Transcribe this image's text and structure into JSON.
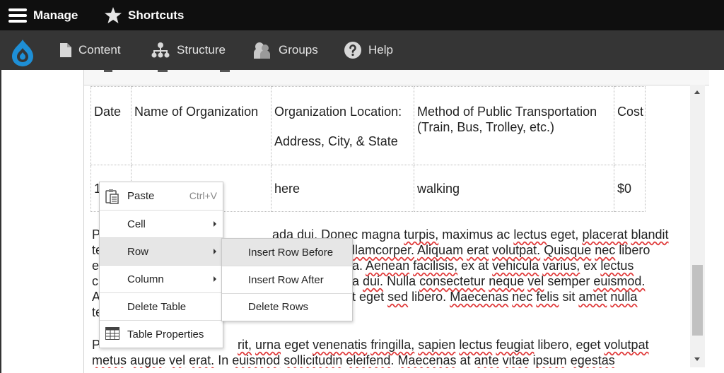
{
  "toolbar": {
    "manage_label": "Manage",
    "shortcuts_label": "Shortcuts"
  },
  "admin_menu": {
    "items": [
      {
        "label": "Content",
        "icon": "document-icon"
      },
      {
        "label": "Structure",
        "icon": "sitemap-icon"
      },
      {
        "label": "Groups",
        "icon": "people-icon"
      },
      {
        "label": "Help",
        "icon": "help-icon"
      }
    ]
  },
  "table": {
    "headers": {
      "date": "Date",
      "org": "Name of Organization",
      "loc_line1": "Organization Location:",
      "loc_line2": "Address, City, & State",
      "method": "Method of Public Transportation (Train, Bus, Trolley, etc.)",
      "cost": "Cost"
    },
    "row": {
      "date": "1",
      "org": "",
      "loc": "here",
      "method": "walking",
      "cost": "$0"
    }
  },
  "paragraph1": {
    "l1a": "P",
    "l1b": "ada dui. Donec magna turpis, maximus ac lectus eget, placerat blandit",
    "l2a": "te",
    "l2b": "llamcorper. Aliquam erat volutpat. Quisque nec libero",
    "l3a": "e",
    "l3b": "a. Aenean facilisis, ex at vehicula varius, ex lectus",
    "l4a": "c",
    "l4b": "a dui. Nulla consectetur neque vel semper euismod.",
    "l5a": "A",
    "l5b": "t eget sed libero. Maecenas nec felis sit amet nulla",
    "l6a": "te"
  },
  "paragraph2": {
    "l1a": "P",
    "l1b": "rit, urna eget venenatis fringilla, sapien lectus feugiat libero, eget volutpat",
    "l2": "metus augue vel erat. In euismod sollicitudin eleifend. Maecenas at ante vitae ipsum egestas"
  },
  "context_menu": {
    "paste_label": "Paste",
    "paste_shortcut": "Ctrl+V",
    "cell_label": "Cell",
    "row_label": "Row",
    "column_label": "Column",
    "delete_table_label": "Delete Table",
    "table_properties_label": "Table Properties"
  },
  "row_submenu": {
    "insert_before": "Insert Row Before",
    "insert_after": "Insert Row After",
    "delete_rows": "Delete Rows"
  },
  "colors": {
    "toolbar_bg": "#0f0f0f",
    "admin_bar_bg": "#353535",
    "drupal_blue": "#1e8fd6",
    "menu_highlight": "#e6e6e6",
    "spell_underline": "#e03a3a"
  }
}
